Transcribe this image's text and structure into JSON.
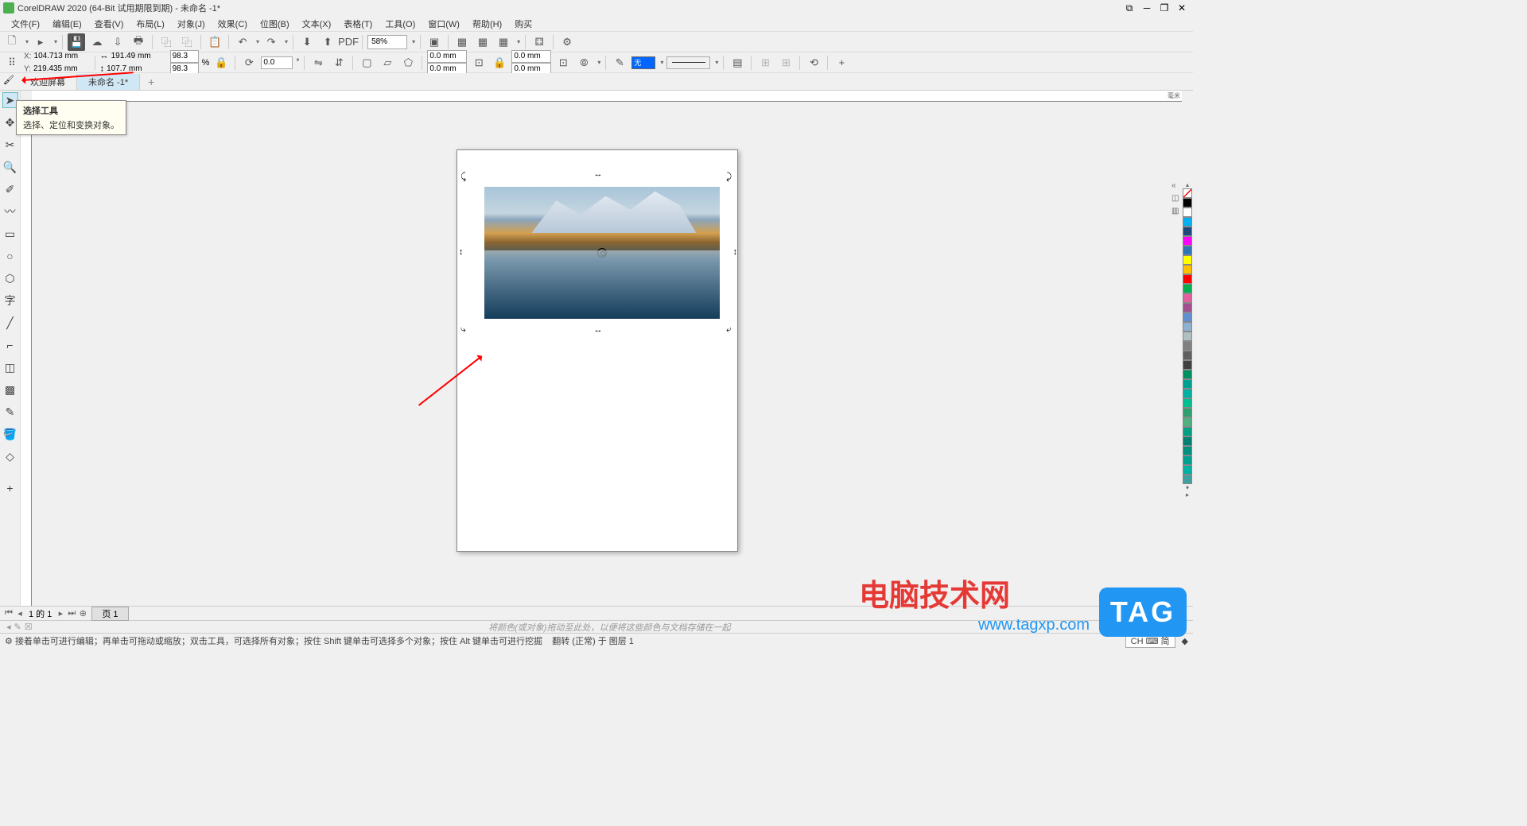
{
  "app": {
    "title": "CorelDRAW 2020 (64-Bit 试用期限到期) - 未命名 -1*",
    "icon_letter": ""
  },
  "window_controls": {
    "popout": "⧉",
    "minimize": "─",
    "maximize": "❐",
    "close": "✕"
  },
  "menu": [
    "文件(F)",
    "编辑(E)",
    "查看(V)",
    "布局(L)",
    "对象(J)",
    "效果(C)",
    "位图(B)",
    "文本(X)",
    "表格(T)",
    "工具(O)",
    "窗口(W)",
    "帮助(H)",
    "购买"
  ],
  "toolbar1": {
    "zoom_value": "58%"
  },
  "property_bar": {
    "x_label": "X:",
    "x": "104.713 mm",
    "y_label": "Y:",
    "y": "219.435 mm",
    "w": "191.49 mm",
    "h": "107.7 mm",
    "scale_x": "98.3",
    "scale_y": "98.3",
    "scale_unit": "%",
    "rotation": "0.0",
    "outline1": "0.0 mm",
    "outline2": "0.0 mm",
    "outline3": "0.0 mm",
    "outline4": "0.0 mm",
    "fill_label": "无"
  },
  "tabs": {
    "tab1": "欢迎屏幕",
    "tab2": "未命名 -1*",
    "add": "+"
  },
  "tooltip": {
    "title": "选择工具",
    "desc": "选择、定位和变换对象。"
  },
  "ruler": {
    "unit": "毫米"
  },
  "palette": [
    "#000000",
    "#ffffff",
    "#00b0f0",
    "#1f497d",
    "#ff00ff",
    "#2e75b6",
    "#ffff00",
    "#ffc000",
    "#ff0000",
    "#00b050",
    "#e060a0",
    "#a05090",
    "#6090d0",
    "#90b0d0",
    "#b0c0c0",
    "#808080",
    "#606060",
    "#404040",
    "#009060",
    "#00a090",
    "#00b0a0",
    "#00c090",
    "#30a070",
    "#50b080",
    "#00a080",
    "#008070",
    "#009080",
    "#00a090",
    "#00b0a0",
    "#40a0a0"
  ],
  "page_nav": {
    "position": "1 的 1",
    "page_tab": "页 1"
  },
  "context_hint": "将颜色(或对象)拖动至此处，以便将这些颜色与文档存储在一起",
  "status": {
    "hint_icon": "⚙",
    "hint": "接着单击可进行编辑；再单击可拖动或缩放；双击工具，可选择所有对象；按住 Shift 键单击可选择多个对象；按住 Alt 键单击可进行挖掘",
    "transform": "翻转 (正常) 于 图层 1",
    "ime": "CH ⌨ 简"
  },
  "watermark": {
    "text1": "电脑技术网",
    "text2": "www.tagxp.com",
    "badge": "TAG"
  }
}
